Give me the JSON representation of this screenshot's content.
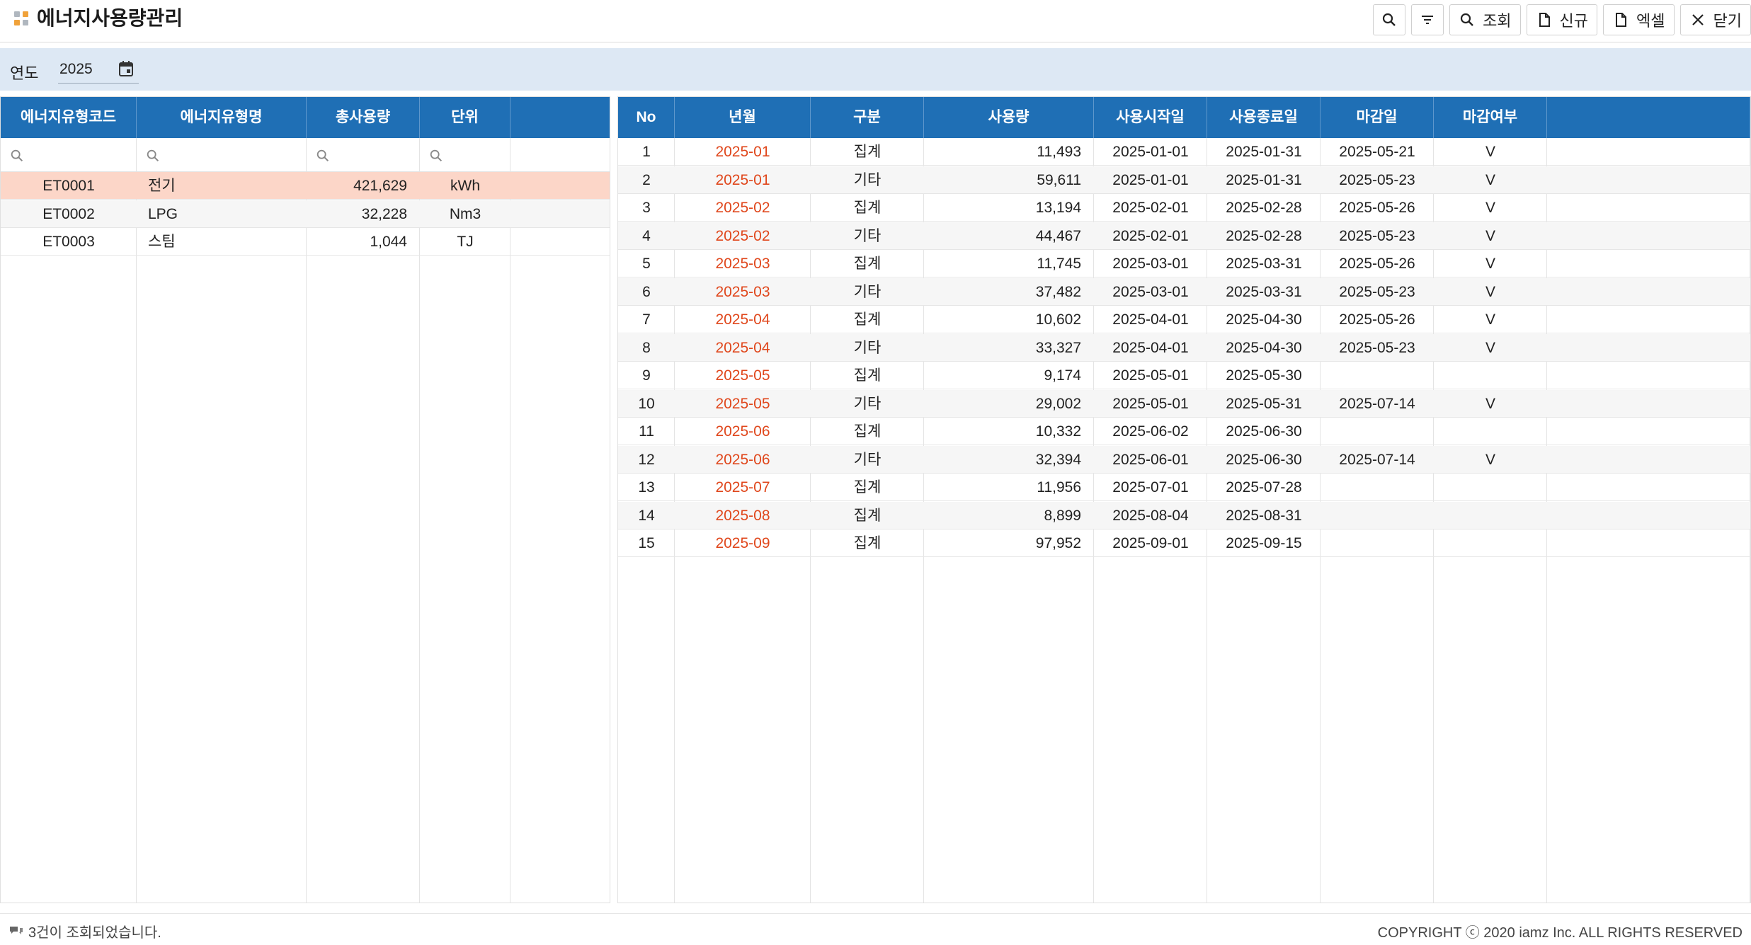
{
  "header": {
    "title": "에너지사용량관리",
    "toolbar": [
      {
        "name": "search-icon-button",
        "icon": "search-icon",
        "label": ""
      },
      {
        "name": "filter-icon-button",
        "icon": "filter-icon",
        "label": ""
      },
      {
        "name": "query-button",
        "icon": "search-icon",
        "label": "조회"
      },
      {
        "name": "new-button",
        "icon": "document-icon",
        "label": "신규"
      },
      {
        "name": "excel-button",
        "icon": "document-icon",
        "label": "엑셀"
      },
      {
        "name": "close-button",
        "icon": "close-icon",
        "label": "닫기"
      }
    ]
  },
  "search": {
    "year_label": "연도",
    "year_value": "2025"
  },
  "left_grid": {
    "columns": [
      "에너지유형코드",
      "에너지유형명",
      "총사용량",
      "단위",
      ""
    ],
    "rows": [
      {
        "code": "ET0001",
        "name": "전기",
        "total": "421,629",
        "unit": "kWh"
      },
      {
        "code": "ET0002",
        "name": "LPG",
        "total": "32,228",
        "unit": "Nm3"
      },
      {
        "code": "ET0003",
        "name": "스팀",
        "total": "1,044",
        "unit": "TJ"
      }
    ]
  },
  "right_grid": {
    "columns": [
      "No",
      "년월",
      "구분",
      "사용량",
      "사용시작일",
      "사용종료일",
      "마감일",
      "마감여부",
      ""
    ],
    "rows": [
      {
        "no": "1",
        "ym": "2025-01",
        "type": "집계",
        "usage": "11,493",
        "start": "2025-01-01",
        "end": "2025-01-31",
        "close": "2025-05-21",
        "closed": "V"
      },
      {
        "no": "2",
        "ym": "2025-01",
        "type": "기타",
        "usage": "59,611",
        "start": "2025-01-01",
        "end": "2025-01-31",
        "close": "2025-05-23",
        "closed": "V"
      },
      {
        "no": "3",
        "ym": "2025-02",
        "type": "집계",
        "usage": "13,194",
        "start": "2025-02-01",
        "end": "2025-02-28",
        "close": "2025-05-26",
        "closed": "V"
      },
      {
        "no": "4",
        "ym": "2025-02",
        "type": "기타",
        "usage": "44,467",
        "start": "2025-02-01",
        "end": "2025-02-28",
        "close": "2025-05-23",
        "closed": "V"
      },
      {
        "no": "5",
        "ym": "2025-03",
        "type": "집계",
        "usage": "11,745",
        "start": "2025-03-01",
        "end": "2025-03-31",
        "close": "2025-05-26",
        "closed": "V"
      },
      {
        "no": "6",
        "ym": "2025-03",
        "type": "기타",
        "usage": "37,482",
        "start": "2025-03-01",
        "end": "2025-03-31",
        "close": "2025-05-23",
        "closed": "V"
      },
      {
        "no": "7",
        "ym": "2025-04",
        "type": "집계",
        "usage": "10,602",
        "start": "2025-04-01",
        "end": "2025-04-30",
        "close": "2025-05-26",
        "closed": "V"
      },
      {
        "no": "8",
        "ym": "2025-04",
        "type": "기타",
        "usage": "33,327",
        "start": "2025-04-01",
        "end": "2025-04-30",
        "close": "2025-05-23",
        "closed": "V"
      },
      {
        "no": "9",
        "ym": "2025-05",
        "type": "집계",
        "usage": "9,174",
        "start": "2025-05-01",
        "end": "2025-05-30",
        "close": "",
        "closed": ""
      },
      {
        "no": "10",
        "ym": "2025-05",
        "type": "기타",
        "usage": "29,002",
        "start": "2025-05-01",
        "end": "2025-05-31",
        "close": "2025-07-14",
        "closed": "V"
      },
      {
        "no": "11",
        "ym": "2025-06",
        "type": "집계",
        "usage": "10,332",
        "start": "2025-06-02",
        "end": "2025-06-30",
        "close": "",
        "closed": ""
      },
      {
        "no": "12",
        "ym": "2025-06",
        "type": "기타",
        "usage": "32,394",
        "start": "2025-06-01",
        "end": "2025-06-30",
        "close": "2025-07-14",
        "closed": "V"
      },
      {
        "no": "13",
        "ym": "2025-07",
        "type": "집계",
        "usage": "11,956",
        "start": "2025-07-01",
        "end": "2025-07-28",
        "close": "",
        "closed": ""
      },
      {
        "no": "14",
        "ym": "2025-08",
        "type": "집계",
        "usage": "8,899",
        "start": "2025-08-04",
        "end": "2025-08-31",
        "close": "",
        "closed": ""
      },
      {
        "no": "15",
        "ym": "2025-09",
        "type": "집계",
        "usage": "97,952",
        "start": "2025-09-01",
        "end": "2025-09-15",
        "close": "",
        "closed": ""
      }
    ]
  },
  "footer": {
    "status": "3건이 조회되었습니다.",
    "copyright": "COPYRIGHT ⓒ 2020 iamz Inc. ALL RIGHTS RESERVED"
  },
  "colors": {
    "header_blue": "#1f6fb5",
    "search_bg": "#dde8f4",
    "selected_row": "#fcd6c8",
    "year_month_text": "#e0471c",
    "accent_orange": "#f0a23a"
  }
}
